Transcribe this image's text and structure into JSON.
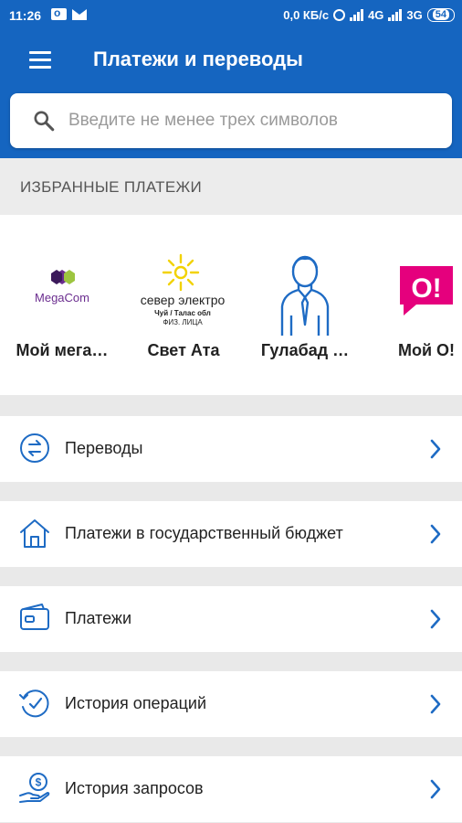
{
  "status_bar": {
    "time": "11:26",
    "speed": "0,0 КБ/с",
    "net1": "4G",
    "net2": "3G",
    "battery": "54"
  },
  "app_bar": {
    "title": "Платежи и переводы"
  },
  "search": {
    "placeholder": "Введите не менее трех символов",
    "value": ""
  },
  "favorites": {
    "header": "ИЗБРАННЫЕ ПЛАТЕЖИ",
    "items": [
      {
        "label": "Мой мега…",
        "logo_text": "MegaCom",
        "icon": "megacom-logo"
      },
      {
        "label": "Свет Ата",
        "logo_text": "север электро",
        "logo_subtext_1": "Чуй / Талас обл",
        "logo_subtext_2": "ФИЗ. ЛИЦА",
        "icon": "severelectro-logo"
      },
      {
        "label": "Гулабад …",
        "icon": "person-icon"
      },
      {
        "label": "Мой О!",
        "logo_text": "O!",
        "icon": "o-logo"
      }
    ]
  },
  "menu": [
    {
      "label": "Переводы",
      "icon": "transfer-icon"
    },
    {
      "label": "Платежи в государственный бюджет",
      "icon": "house-icon"
    },
    {
      "label": "Платежи",
      "icon": "wallet-icon"
    },
    {
      "label": "История операций",
      "icon": "history-icon"
    },
    {
      "label": "История запросов",
      "icon": "money-hand-icon"
    }
  ],
  "colors": {
    "primary": "#1565c0",
    "icon_blue": "#1e6bc4",
    "o_pink": "#e5007d",
    "megacom_purple": "#6b2d8f",
    "megacom_green": "#9dc540",
    "sever_yellow": "#f2d200"
  }
}
